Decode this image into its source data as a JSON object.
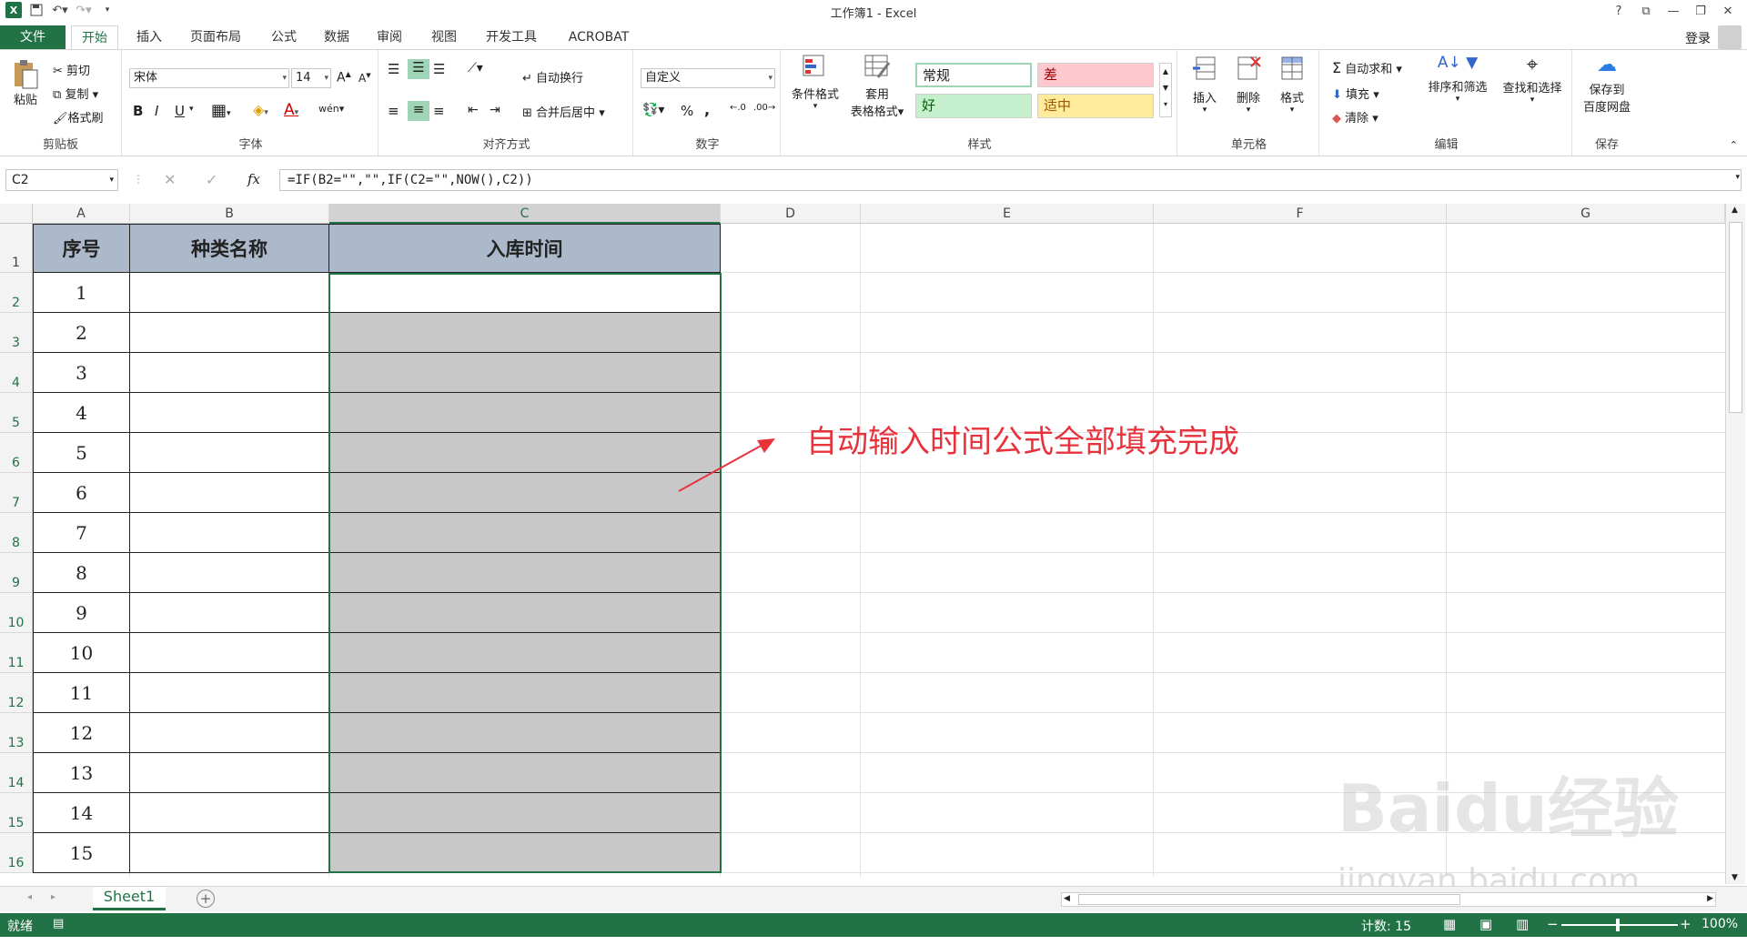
{
  "window": {
    "title": "工作簿1 - Excel",
    "help": "?",
    "controls": [
      "⧉",
      "—",
      "❐",
      "✕"
    ]
  },
  "tabs": {
    "file": "文件",
    "home": "开始",
    "insert": "插入",
    "page_layout": "页面布局",
    "formulas": "公式",
    "data": "数据",
    "review": "审阅",
    "view": "视图",
    "developer": "开发工具",
    "acrobat": "ACROBAT",
    "sign_in": "登录"
  },
  "ribbon": {
    "clipboard": {
      "label": "剪贴板",
      "paste": "粘贴",
      "cut": "剪切",
      "copy": "复制",
      "format_painter": "格式刷"
    },
    "font": {
      "label": "字体",
      "font_name": "宋体",
      "font_size": "14",
      "bold": "B",
      "italic": "I",
      "underline": "U",
      "wen": "wén"
    },
    "alignment": {
      "label": "对齐方式",
      "wrap_text": "自动换行",
      "merge_center": "合并后居中"
    },
    "number": {
      "label": "数字",
      "format": "自定义",
      "percent": "%",
      "comma": ","
    },
    "styles": {
      "label": "样式",
      "conditional": "条件格式",
      "table_format_line1": "套用",
      "table_format_line2": "表格格式",
      "normal": "常规",
      "bad": "差",
      "good": "好",
      "neutral": "适中"
    },
    "cells": {
      "label": "单元格",
      "insert": "插入",
      "delete": "删除",
      "format": "格式"
    },
    "editing": {
      "label": "编辑",
      "autosum": "自动求和",
      "fill": "填充",
      "clear": "清除",
      "sort_filter": "排序和筛选",
      "find_select": "查找和选择"
    },
    "save": {
      "label": "保存",
      "save_line1": "保存到",
      "save_line2": "百度网盘"
    }
  },
  "formula_bar": {
    "name_box": "C2",
    "fx": "fx",
    "formula": "=IF(B2=\"\",\"\",IF(C2=\"\",NOW(),C2))"
  },
  "grid": {
    "columns": [
      "A",
      "B",
      "C",
      "D",
      "E",
      "F",
      "G"
    ],
    "rows": [
      "1",
      "2",
      "3",
      "4",
      "5",
      "6",
      "7",
      "8",
      "9",
      "10",
      "11",
      "12",
      "13",
      "14",
      "15",
      "16"
    ],
    "header_row": [
      "序号",
      "种类名称",
      "入库时间"
    ],
    "serials": [
      "1",
      "2",
      "3",
      "4",
      "5",
      "6",
      "7",
      "8",
      "9",
      "10",
      "11",
      "12",
      "13",
      "14",
      "15"
    ],
    "annotation": "自动输入时间公式全部填充完成"
  },
  "sheets": {
    "active": "Sheet1",
    "add": "+"
  },
  "status": {
    "ready": "就绪",
    "count": "计数: 15",
    "zoom": "100%"
  },
  "watermark": {
    "logo": "Baidu经验",
    "url": "jingyan.baidu.com"
  },
  "colors": {
    "excel_green": "#217346",
    "header_fill": "#acb9ca",
    "selected_fill": "#c8c8c8",
    "annotation_red": "#e8333c"
  }
}
